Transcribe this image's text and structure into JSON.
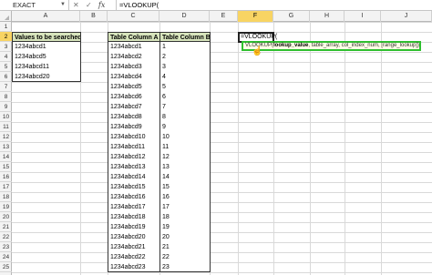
{
  "formula_bar": {
    "name_box": "EXACT",
    "cancel": "✕",
    "enter": "✓",
    "fx": "fx",
    "formula": "=VLOOKUP("
  },
  "columns": [
    "A",
    "B",
    "C",
    "D",
    "E",
    "F",
    "G",
    "H",
    "I",
    "J"
  ],
  "active_column": "F",
  "rows": [
    "1",
    "2",
    "3",
    "4",
    "5",
    "6",
    "7",
    "8",
    "9",
    "10",
    "11",
    "12",
    "13",
    "14",
    "15",
    "16",
    "17",
    "18",
    "19",
    "20",
    "21",
    "22",
    "23",
    "24",
    "25"
  ],
  "active_row": "2",
  "search_table": {
    "header": "Values to be searched",
    "values": [
      "1234abcd1",
      "1234abcd5",
      "1234abcd11",
      "1234abcd20"
    ]
  },
  "lookup_table": {
    "header_a": "Table Column A",
    "header_b": "Table Column B",
    "col_a": [
      "1234abcd1",
      "1234abcd2",
      "1234abcd3",
      "1234abcd4",
      "1234abcd5",
      "1234abcd6",
      "1234abcd7",
      "1234abcd8",
      "1234abcd9",
      "1234abcd10",
      "1234abcd11",
      "1234abcd12",
      "1234abcd13",
      "1234abcd14",
      "1234abcd15",
      "1234abcd16",
      "1234abcd17",
      "1234abcd18",
      "1234abcd19",
      "1234abcd20",
      "1234abcd21",
      "1234abcd22",
      "1234abcd23"
    ],
    "col_b": [
      "1",
      "2",
      "3",
      "4",
      "5",
      "6",
      "7",
      "8",
      "9",
      "10",
      "11",
      "12",
      "13",
      "14",
      "15",
      "16",
      "17",
      "18",
      "19",
      "20",
      "21",
      "22",
      "23"
    ]
  },
  "active_cell_text": "=VLOOKUP(",
  "tooltip": {
    "fn": "VLOOKUP(",
    "arg1": "lookup_value",
    "rest": ", table_array, col_index_num, [range_lookup])"
  },
  "colors": {
    "header_fill": "#d7e4bc",
    "active_header": "#f8d463",
    "tooltip_border": "#2fbf2f"
  }
}
